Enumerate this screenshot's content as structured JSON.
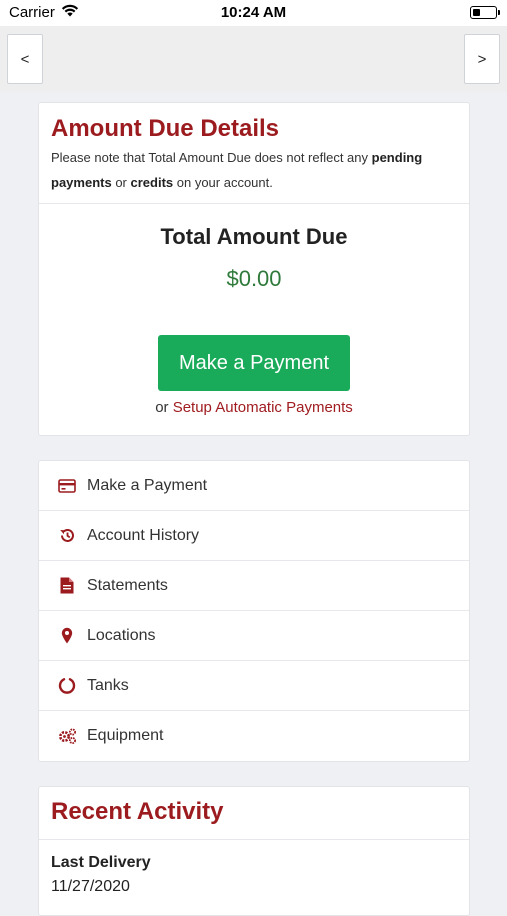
{
  "status_bar": {
    "carrier": "Carrier",
    "time": "10:24 AM"
  },
  "nav": {
    "prev_label": "<",
    "next_label": ">"
  },
  "amount_due": {
    "title": "Amount Due Details",
    "note_prefix": "Please note that Total Amount Due does not reflect any ",
    "note_bold_1": "pending payments",
    "note_mid": " or ",
    "note_bold_2": "credits",
    "note_suffix": " on your account.",
    "total_label": "Total Amount Due",
    "total_value": "$0.00",
    "pay_button": "Make a Payment",
    "auto_prefix": "or ",
    "auto_link": "Setup Automatic Payments"
  },
  "menu": {
    "items": [
      {
        "label": "Make a Payment",
        "icon": "credit-card-icon"
      },
      {
        "label": "Account History",
        "icon": "history-icon"
      },
      {
        "label": "Statements",
        "icon": "document-icon"
      },
      {
        "label": "Locations",
        "icon": "map-pin-icon"
      },
      {
        "label": "Tanks",
        "icon": "tank-gauge-icon"
      },
      {
        "label": "Equipment",
        "icon": "gears-icon"
      }
    ]
  },
  "recent_activity": {
    "title": "Recent Activity",
    "last_delivery_label": "Last Delivery",
    "last_delivery_date": "11/27/2020"
  },
  "colors": {
    "brand_red": "#9b1b1f",
    "pay_green": "#1aab5a",
    "amount_green": "#2f7a3a"
  }
}
